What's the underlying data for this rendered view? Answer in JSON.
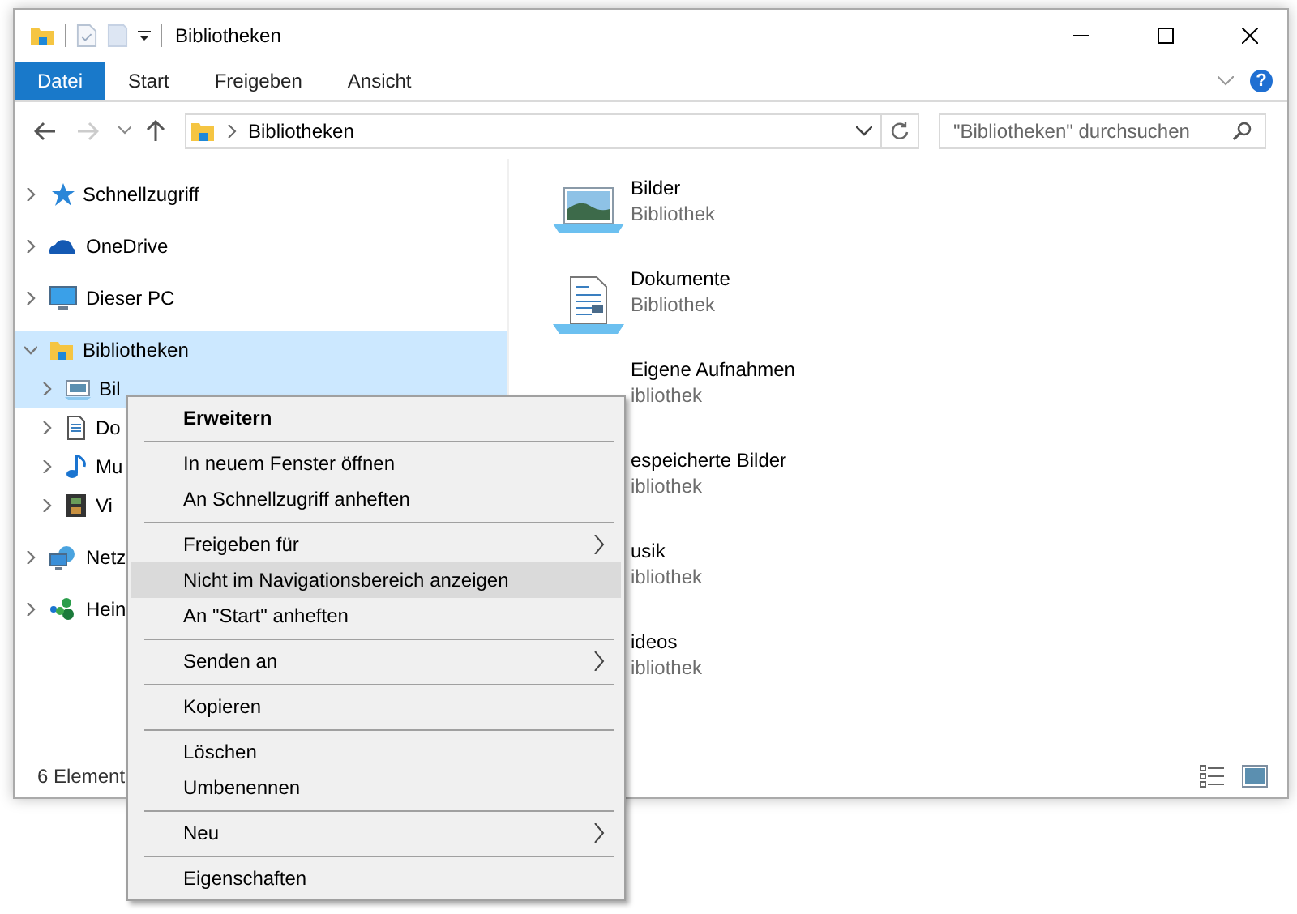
{
  "window": {
    "title": "Bibliotheken"
  },
  "ribbon": {
    "tabs": [
      {
        "label": "Datei",
        "selected": true
      },
      {
        "label": "Start",
        "selected": false
      },
      {
        "label": "Freigeben",
        "selected": false
      },
      {
        "label": "Ansicht",
        "selected": false
      }
    ],
    "help": "?"
  },
  "address_bar": {
    "back_disabled": false,
    "forward_disabled": true,
    "path": "Bibliotheken"
  },
  "search": {
    "placeholder": "\"Bibliotheken\" durchsuchen"
  },
  "sidebar": {
    "items": [
      {
        "label": "Schnellzugriff",
        "kind": "star",
        "expanded": false,
        "selected": false
      },
      {
        "label": "OneDrive",
        "kind": "cloud",
        "expanded": false,
        "selected": false
      },
      {
        "label": "Dieser PC",
        "kind": "pc",
        "expanded": false,
        "selected": false
      },
      {
        "label": "Bibliotheken",
        "kind": "library",
        "expanded": true,
        "selected": true,
        "children": [
          {
            "label": "Bil",
            "kind": "pictures",
            "expanded": false,
            "selected": true
          },
          {
            "label": "Do",
            "kind": "documents",
            "expanded": false,
            "selected": false
          },
          {
            "label": "Mu",
            "kind": "music",
            "expanded": false,
            "selected": false
          },
          {
            "label": "Vi",
            "kind": "video",
            "expanded": false,
            "selected": false
          }
        ]
      },
      {
        "label": "Netz",
        "kind": "network",
        "expanded": false,
        "selected": false
      },
      {
        "label": "Hein",
        "kind": "homegroup",
        "expanded": false,
        "selected": false
      }
    ]
  },
  "content": {
    "items": [
      {
        "name": "Bilder",
        "type": "Bibliothek",
        "kind": "pictures"
      },
      {
        "name": "Dokumente",
        "type": "Bibliothek",
        "kind": "documents"
      },
      {
        "name": "Eigene Aufnahmen",
        "type": "ibliothek"
      },
      {
        "name": "espeicherte Bilder",
        "type": "ibliothek"
      },
      {
        "name": "usik",
        "type": "ibliothek"
      },
      {
        "name": "ideos",
        "type": "ibliothek"
      }
    ]
  },
  "status_bar": {
    "count": "6 Element"
  },
  "context_menu": {
    "items": [
      {
        "kind": "item",
        "label": "Erweitern",
        "bold": true,
        "submenu": false,
        "selected": false
      },
      {
        "kind": "separator"
      },
      {
        "kind": "item",
        "label": "In neuem Fenster öffnen",
        "bold": false,
        "submenu": false,
        "selected": false
      },
      {
        "kind": "item",
        "label": "An Schnellzugriff anheften",
        "bold": false,
        "submenu": false,
        "selected": false
      },
      {
        "kind": "separator"
      },
      {
        "kind": "item",
        "label": "Freigeben für",
        "bold": false,
        "submenu": true,
        "selected": false
      },
      {
        "kind": "item",
        "label": "Nicht im Navigationsbereich anzeigen",
        "bold": false,
        "submenu": false,
        "selected": true
      },
      {
        "kind": "item",
        "label": "An \"Start\" anheften",
        "bold": false,
        "submenu": false,
        "selected": false
      },
      {
        "kind": "separator"
      },
      {
        "kind": "item",
        "label": "Senden an",
        "bold": false,
        "submenu": true,
        "selected": false
      },
      {
        "kind": "separator"
      },
      {
        "kind": "item",
        "label": "Kopieren",
        "bold": false,
        "submenu": false,
        "selected": false
      },
      {
        "kind": "separator"
      },
      {
        "kind": "item",
        "label": "Löschen",
        "bold": false,
        "submenu": false,
        "selected": false
      },
      {
        "kind": "item",
        "label": "Umbenennen",
        "bold": false,
        "submenu": false,
        "selected": false
      },
      {
        "kind": "separator"
      },
      {
        "kind": "item",
        "label": "Neu",
        "bold": false,
        "submenu": true,
        "selected": false
      },
      {
        "kind": "separator"
      },
      {
        "kind": "item",
        "label": "Eigenschaften",
        "bold": false,
        "submenu": false,
        "selected": false
      }
    ]
  }
}
